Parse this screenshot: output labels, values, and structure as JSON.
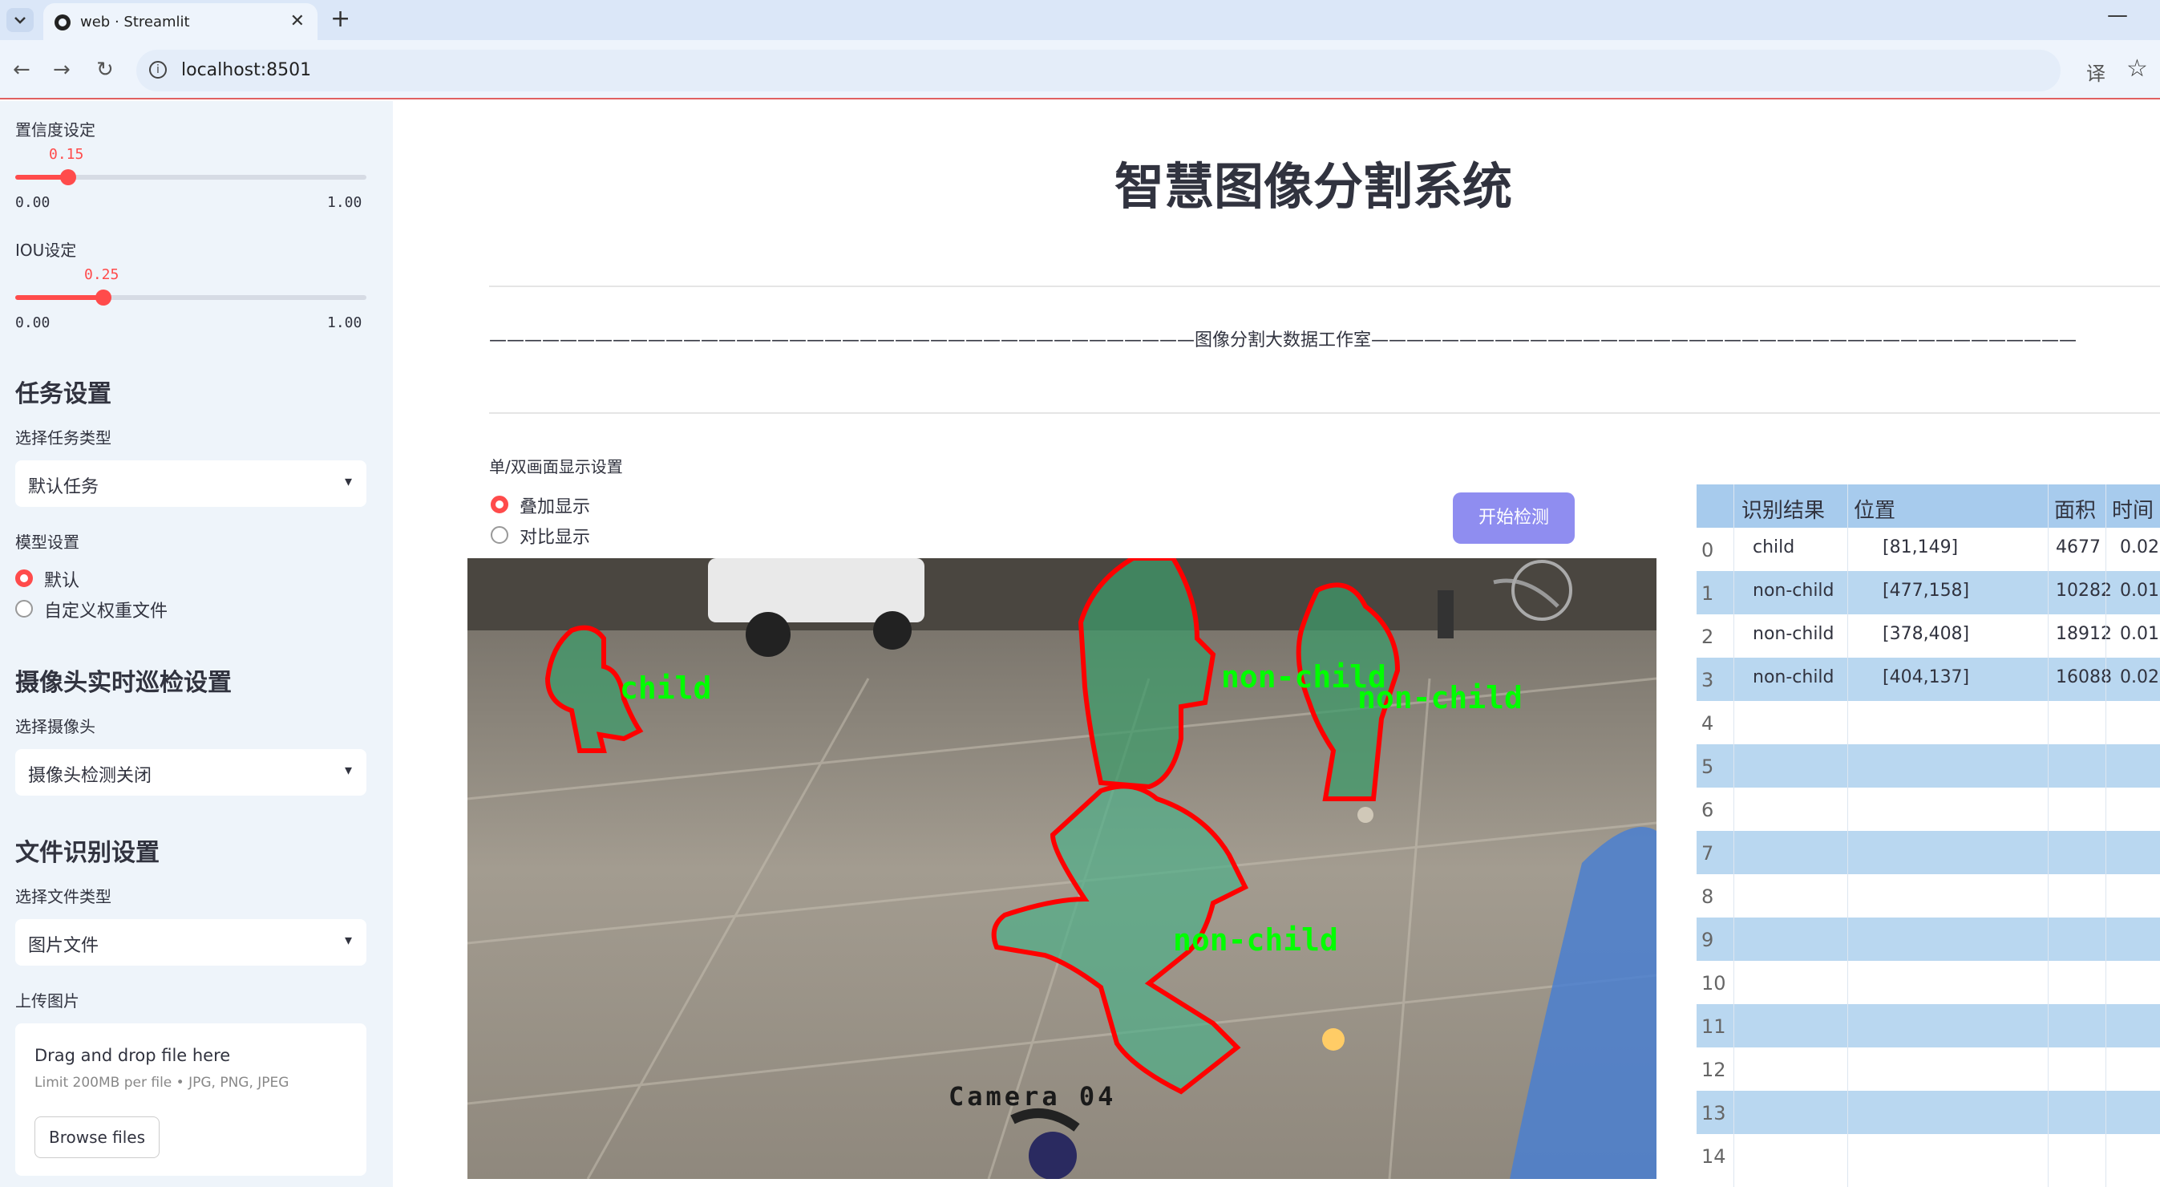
{
  "browser": {
    "tab_title": "web · Streamlit",
    "tab_close": "✕",
    "new_tab": "+",
    "minimize": "—",
    "url": "localhost:8501",
    "back": "←",
    "forward": "→",
    "reload": "↻",
    "info": "i",
    "translate": "译",
    "bookmark": "☆"
  },
  "sidebar": {
    "conf_label": "置信度设定",
    "conf_value": "0.15",
    "conf_fraction": 0.15,
    "conf_min": "0.00",
    "conf_max": "1.00",
    "iou_label": "IOU设定",
    "iou_value": "0.25",
    "iou_fraction": 0.25,
    "iou_min": "0.00",
    "iou_max": "1.00",
    "task_heading": "任务设置",
    "task_type_label": "选择任务类型",
    "task_type_value": "默认任务",
    "model_label": "模型设置",
    "model_options": [
      "默认",
      "自定义权重文件"
    ],
    "camera_heading": "摄像头实时巡检设置",
    "camera_label": "选择摄像头",
    "camera_value": "摄像头检测关闭",
    "file_heading": "文件识别设置",
    "file_type_label": "选择文件类型",
    "file_type_value": "图片文件",
    "upload_label": "上传图片",
    "upload_drop": "Drag and drop file here",
    "upload_limit": "Limit 200MB per file • JPG, PNG, JPEG",
    "upload_button": "Browse files",
    "caret": "▾"
  },
  "main": {
    "title": "智慧图像分割系统",
    "studio_line": "————————————————————————————————————————图像分割大数据工作室————————————————————————————————————————",
    "display_label": "单/双画面显示设置",
    "display_options": [
      "叠加显示",
      "对比显示"
    ],
    "start_button": "开始检测",
    "detections": [
      {
        "label": "child"
      },
      {
        "label": "non-child"
      },
      {
        "label": "non-child"
      },
      {
        "label": "non-child"
      }
    ],
    "camera_text": "Camera 04"
  },
  "table": {
    "headers": [
      "识别结果",
      "位置",
      "面积",
      "时间"
    ],
    "rows": [
      {
        "idx": "0",
        "result": "child",
        "pos": "[81,149]",
        "area": "4677",
        "time": "0.02"
      },
      {
        "idx": "1",
        "result": "non-child",
        "pos": "[477,158]",
        "area": "10282",
        "time": "0.01"
      },
      {
        "idx": "2",
        "result": "non-child",
        "pos": "[378,408]",
        "area": "18912",
        "time": "0.01"
      },
      {
        "idx": "3",
        "result": "non-child",
        "pos": "[404,137]",
        "area": "16088",
        "time": "0.02"
      },
      {
        "idx": "4",
        "result": "",
        "pos": "",
        "area": "",
        "time": ""
      },
      {
        "idx": "5",
        "result": "",
        "pos": "",
        "area": "",
        "time": ""
      },
      {
        "idx": "6",
        "result": "",
        "pos": "",
        "area": "",
        "time": ""
      },
      {
        "idx": "7",
        "result": "",
        "pos": "",
        "area": "",
        "time": ""
      },
      {
        "idx": "8",
        "result": "",
        "pos": "",
        "area": "",
        "time": ""
      },
      {
        "idx": "9",
        "result": "",
        "pos": "",
        "area": "",
        "time": ""
      },
      {
        "idx": "10",
        "result": "",
        "pos": "",
        "area": "",
        "time": ""
      },
      {
        "idx": "11",
        "result": "",
        "pos": "",
        "area": "",
        "time": ""
      },
      {
        "idx": "12",
        "result": "",
        "pos": "",
        "area": "",
        "time": ""
      },
      {
        "idx": "13",
        "result": "",
        "pos": "",
        "area": "",
        "time": ""
      },
      {
        "idx": "14",
        "result": "",
        "pos": "",
        "area": "",
        "time": ""
      }
    ]
  },
  "colors": {
    "accent": "#ff4b4b",
    "button": "#8f8df0",
    "mask": "#2e8b57",
    "outline": "#ff0000",
    "label_text": "#00ff00"
  }
}
